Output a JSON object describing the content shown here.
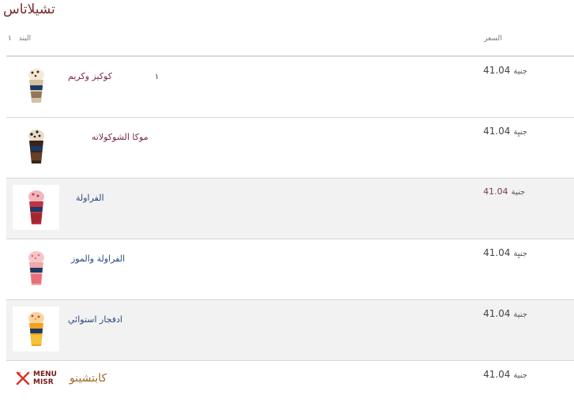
{
  "page": {
    "title": "تشيلاتاس"
  },
  "table": {
    "header_item": "البند",
    "header_qty": "١",
    "header_price": "السعر"
  },
  "rows": [
    {
      "name": "كوكيز وكريم",
      "qty": "١",
      "price": "41.04",
      "currency": "جنية",
      "image": "cookies-cream-frappe-image",
      "cup_colors": [
        "#f4ead8",
        "#4a2a1a",
        "#d6c2a0"
      ]
    },
    {
      "name": "موكا الشوكولاته",
      "price": "41.04",
      "currency": "جنيِة",
      "image": "mocha-chocolate-frappe-image",
      "cup_colors": [
        "#3a2418",
        "#6a3e26",
        "#2a1a10"
      ]
    },
    {
      "name": "الفراولة",
      "price": "41.04",
      "currency": "جنية",
      "image": "strawberry-frappe-image",
      "cup_colors": [
        "#e8586a",
        "#c23242",
        "#a0282e"
      ]
    },
    {
      "name": "الفراولة والموز",
      "price": "41.04",
      "currency": "جنيِة",
      "image": "strawberry-banana-frappe-image",
      "cup_colors": [
        "#f5c6c8",
        "#e8707a",
        "#f2a6a8"
      ]
    },
    {
      "name": "ادفجار استوائي",
      "price": "41.04",
      "currency": "جنية",
      "image": "tropical-frappe-image",
      "cup_colors": [
        "#f4a21a",
        "#e88a10",
        "#f6c23a"
      ]
    },
    {
      "name": "كابتشينو",
      "price": "41.04",
      "currency": "جنية",
      "logo_lines": [
        "MENU",
        "MISR"
      ]
    }
  ],
  "colors": {
    "accent": "#7a2a2a",
    "row_alt": "#f2f2f2",
    "divider": "#d6d6d6"
  }
}
